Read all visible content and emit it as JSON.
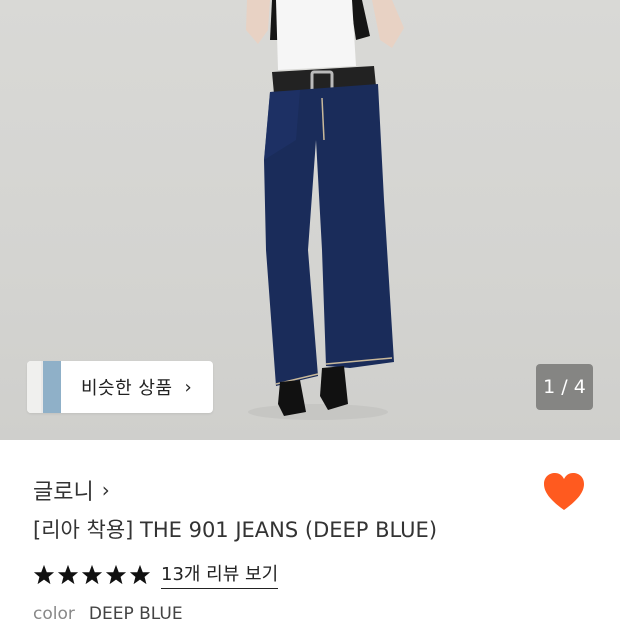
{
  "hero": {
    "similar_button_label": "비슷한 상품",
    "page_counter": "1 / 4"
  },
  "product": {
    "brand": "글로니",
    "title": "[리아 착용] THE 901 JEANS (DEEP BLUE)",
    "rating_stars": 5,
    "review_link": "13개 리뷰 보기",
    "color_label": "color",
    "color_value": "DEEP BLUE",
    "wishlisted": true
  },
  "colors": {
    "heart": "#ff5a1f",
    "denim": "#1a2c5a",
    "background_hero": "#d6d6d3"
  },
  "icons": {
    "brand_chevron": "chevron-right-icon",
    "similar_chevron": "chevron-right-icon",
    "wishlist": "heart-icon",
    "star": "star-icon"
  }
}
